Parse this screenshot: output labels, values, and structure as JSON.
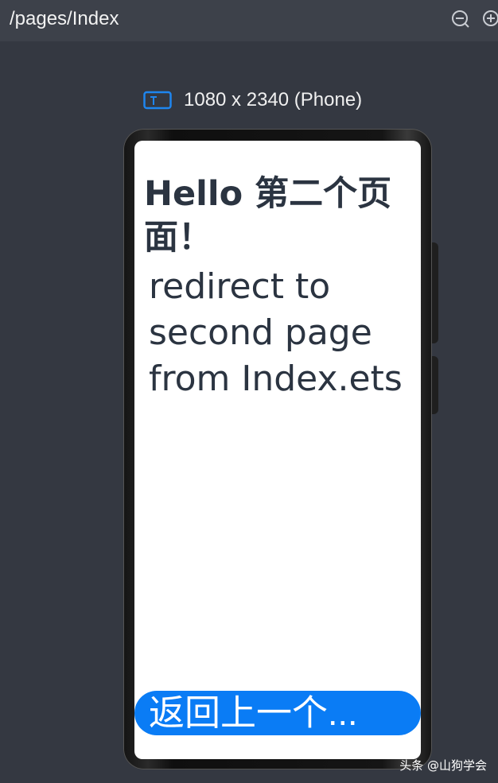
{
  "editor": {
    "path": "/pages/Index",
    "zoom_out_icon": "zoom-out-icon",
    "zoom_in_icon": "zoom-in-icon",
    "device_icon": "device-type-icon",
    "device_label": "1080 x 2340 (Phone)"
  },
  "screen": {
    "hello_text": "Hello 第二个页面！",
    "redirect_text": "redirect to second page from Index.ets",
    "back_button_label": "返回上一个..."
  },
  "watermark": "头条 @山狗学会",
  "colors": {
    "background": "#343841",
    "accent_blue": "#0a7cf5",
    "text_dark": "#2b3441"
  }
}
